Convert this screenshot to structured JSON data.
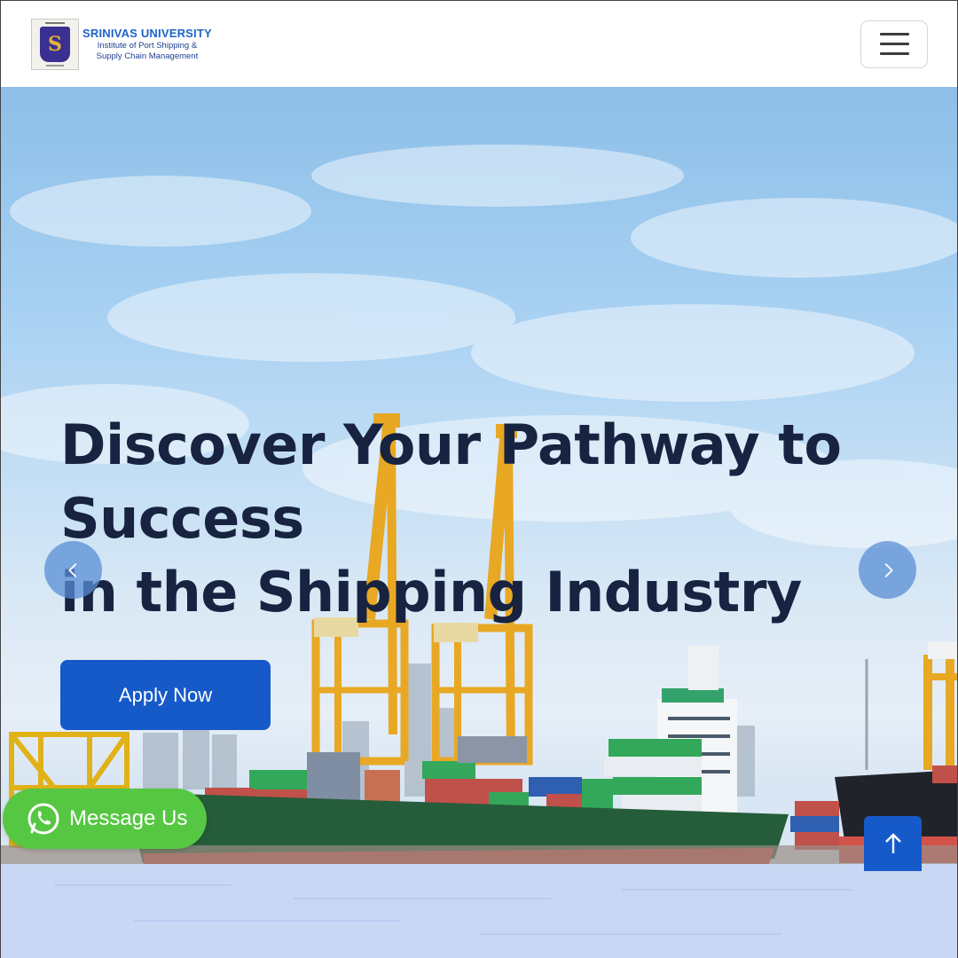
{
  "brand": {
    "title": "SRINIVAS UNIVERSITY",
    "subtitle_line1": "Institute of Port Shipping &",
    "subtitle_line2": "Supply Chain Management"
  },
  "navbar": {
    "menu_icon": "hamburger-menu-icon"
  },
  "hero": {
    "heading_line1": "Discover Your Pathway to",
    "heading_line2": "Success",
    "heading_line3": "in the Shipping Industry",
    "cta_label": "Apply Now",
    "prev_icon": "chevron-left-icon",
    "next_icon": "chevron-right-icon"
  },
  "floating": {
    "whatsapp_label": "Message Us",
    "whatsapp_icon": "whatsapp-icon",
    "scroll_top_icon": "arrow-up-icon"
  },
  "colors": {
    "primary": "#1659c9",
    "heading": "#172340",
    "whatsapp": "#56c742",
    "brand_blue": "#1e63c8"
  }
}
